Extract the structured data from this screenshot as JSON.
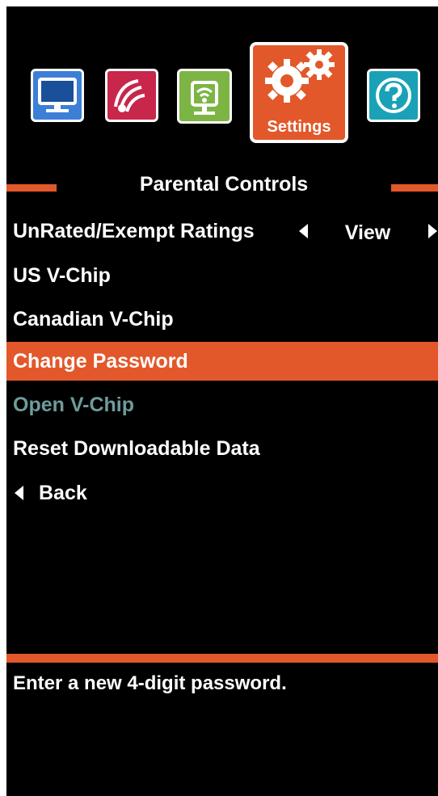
{
  "colors": {
    "background": "#000000",
    "accent": "#e2582a",
    "text": "#ffffff",
    "disabled_text": "#6f9b9b",
    "tile_tv": "#3d7fd6",
    "tile_audio": "#c8264a",
    "tile_network": "#7db544",
    "tile_help": "#1aa1b8"
  },
  "icon_bar": {
    "tiles": [
      {
        "icon": "tv-icon"
      },
      {
        "icon": "audio-icon"
      },
      {
        "icon": "network-icon"
      },
      {
        "icon": "gears-icon",
        "label": "Settings",
        "selected": true
      },
      {
        "icon": "question-icon"
      }
    ]
  },
  "header": {
    "title": "Parental Controls"
  },
  "menu": {
    "unrated": {
      "label": "UnRated/Exempt Ratings",
      "value": "View"
    },
    "us_vchip": {
      "label": "US V-Chip"
    },
    "canadian_vchip": {
      "label": "Canadian V-Chip"
    },
    "change_password": {
      "label": "Change Password",
      "selected": true
    },
    "open_vchip": {
      "label": "Open V-Chip",
      "disabled": true
    },
    "reset_data": {
      "label": "Reset Downloadable Data"
    },
    "back": {
      "label": "Back"
    }
  },
  "help": {
    "text": "Enter a new 4-digit password."
  }
}
